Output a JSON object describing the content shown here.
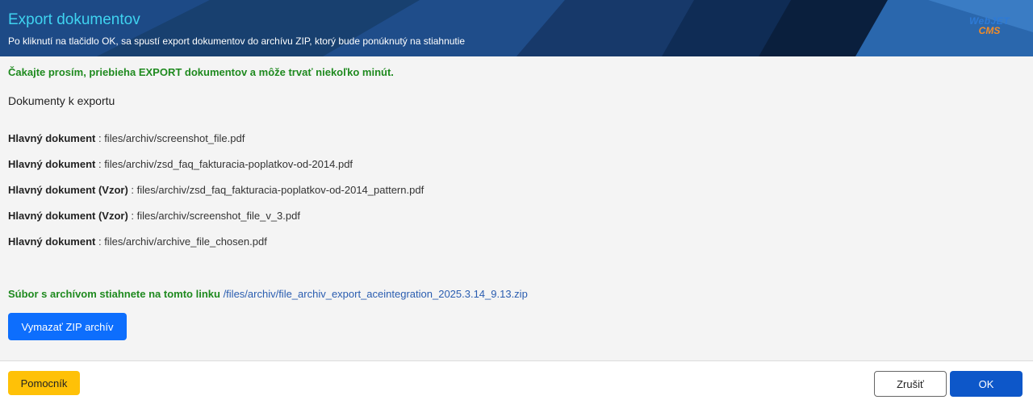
{
  "dialog": {
    "title": "Export dokumentov",
    "subtitle": "Po kliknutí na tlačidlo OK, sa spustí export dokumentov do archívu ZIP, ktorý bude ponúknutý na stiahnutie",
    "logo_line1": "WebJET",
    "logo_line2": "CMS"
  },
  "content": {
    "wait_message": "Čakajte prosím, priebieha EXPORT dokumentov a môže trvať niekoľko minút.",
    "section_title": "Dokumenty k exportu",
    "documents": [
      {
        "label": "Hlavný dokument",
        "path": " : files/archiv/screenshot_file.pdf"
      },
      {
        "label": "Hlavný dokument",
        "path": " : files/archiv/zsd_faq_fakturacia-poplatkov-od-2014.pdf"
      },
      {
        "label": "Hlavný dokument (Vzor)",
        "path": " : files/archiv/zsd_faq_fakturacia-poplatkov-od-2014_pattern.pdf"
      },
      {
        "label": "Hlavný dokument (Vzor)",
        "path": " : files/archiv/screenshot_file_v_3.pdf"
      },
      {
        "label": "Hlavný dokument",
        "path": " : files/archiv/archive_file_chosen.pdf"
      }
    ],
    "download_label": "Súbor s archívom stiahnete na tomto linku",
    "download_link": "/files/archiv/file_archiv_export_aceintegration_2025.3.14_9.13.zip",
    "delete_button": "Vymazať ZIP archív"
  },
  "footer": {
    "help_button": "Pomocník",
    "cancel_button": "Zrušiť",
    "ok_button": "OK"
  },
  "colors": {
    "header_bg": "#1a3f72",
    "title": "#3fd3f0",
    "success_green": "#1f8a1f",
    "primary_blue": "#0d6efd",
    "help_yellow": "#ffc107"
  }
}
